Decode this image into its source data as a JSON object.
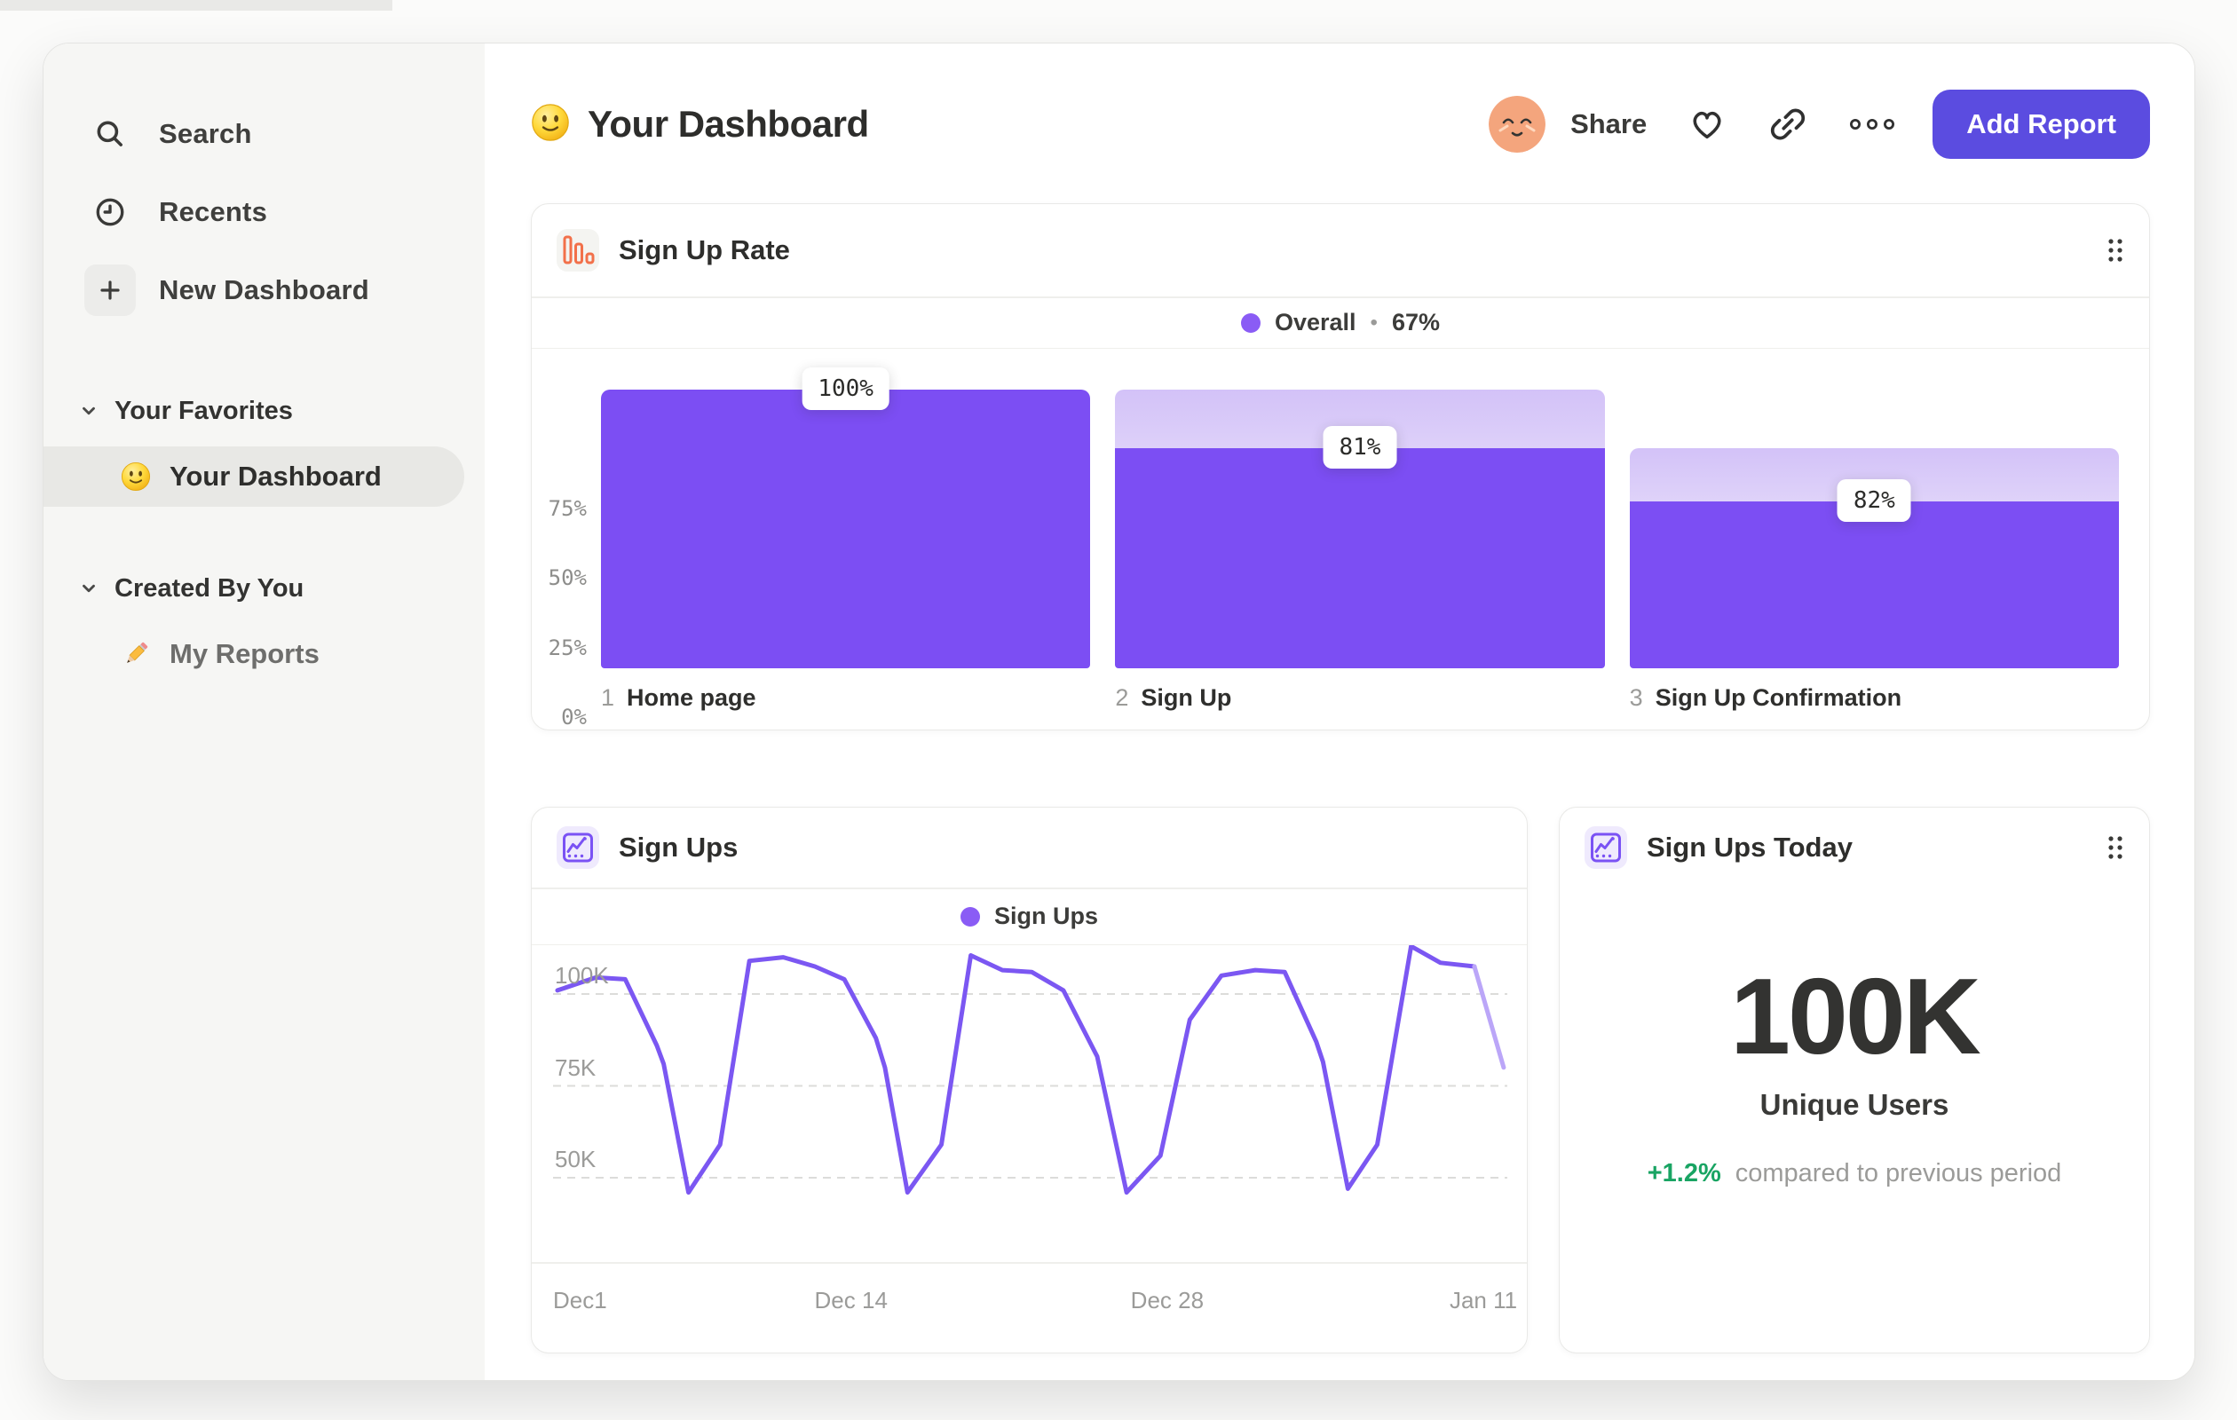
{
  "colors": {
    "bar_purple": "#7c4ef3",
    "line_purple": "#7b57f2",
    "line_purple_light": "#bba6f8",
    "legend_dot_purple": "#8a5cf5",
    "button_purple": "#5b4ce0",
    "green": "#19a463",
    "icon_orange": "#f2704a",
    "icon_purple": "#7a52f4",
    "avatar_peach": "#f4a57d"
  },
  "sidebar": {
    "nav": [
      {
        "icon": "search-icon",
        "label": "Search",
        "boxed": false
      },
      {
        "icon": "clock-icon",
        "label": "Recents",
        "boxed": false
      },
      {
        "icon": "plus-icon",
        "label": "New Dashboard",
        "boxed": true
      }
    ],
    "sections": [
      {
        "label": "Your Favorites",
        "items": [
          {
            "icon": "smiley-emoji",
            "label": "Your Dashboard",
            "selected": true
          }
        ]
      },
      {
        "label": "Created By You",
        "items": [
          {
            "icon": "pencil-emoji",
            "label": "My Reports",
            "selected": false
          }
        ]
      }
    ]
  },
  "header": {
    "title": "Your Dashboard",
    "share": "Share",
    "add_report": "Add Report"
  },
  "funnel_card": {
    "title": "Sign Up Rate",
    "legend": {
      "label": "Overall",
      "separator": "•",
      "value": "67%"
    },
    "y_ticks": [
      {
        "label": "75%",
        "pct": 75
      },
      {
        "label": "50%",
        "pct": 50
      },
      {
        "label": "25%",
        "pct": 25
      },
      {
        "label": "0%",
        "pct": 0
      }
    ],
    "steps": [
      {
        "index": "1",
        "label": "Home page",
        "value_label": "100%",
        "solid_pct": 100,
        "ghost_pct": 0
      },
      {
        "index": "2",
        "label": "Sign Up",
        "value_label": "81%",
        "solid_pct": 79,
        "ghost_pct": 100
      },
      {
        "index": "3",
        "label": "Sign Up Confirmation",
        "value_label": "82%",
        "solid_pct": 60,
        "ghost_pct": 79
      }
    ]
  },
  "line_card": {
    "title": "Sign Ups",
    "legend": {
      "label": "Sign Ups"
    },
    "y_ticks": [
      {
        "label": "100K",
        "value": 100
      },
      {
        "label": "75K",
        "value": 75
      },
      {
        "label": "50K",
        "value": 50
      }
    ],
    "x_ticks": [
      {
        "label": "Dec1",
        "day": 0
      },
      {
        "label": "Dec 14",
        "day": 13
      },
      {
        "label": "Dec 28",
        "day": 27
      },
      {
        "label": "Jan 11",
        "day": 41
      }
    ],
    "solid_points": [
      [
        0,
        101
      ],
      [
        1.7,
        104.5
      ],
      [
        3,
        104
      ],
      [
        4.4,
        86
      ],
      [
        4.7,
        81
      ],
      [
        5.8,
        46
      ],
      [
        7.2,
        59
      ],
      [
        8.5,
        109
      ],
      [
        10,
        110
      ],
      [
        11.4,
        107.5
      ],
      [
        12.7,
        104
      ],
      [
        14.1,
        88
      ],
      [
        14.5,
        80
      ],
      [
        15.5,
        46
      ],
      [
        17,
        59
      ],
      [
        18.3,
        110.5
      ],
      [
        19.7,
        106.5
      ],
      [
        21,
        106
      ],
      [
        22.4,
        101
      ],
      [
        23.9,
        83
      ],
      [
        25.2,
        46
      ],
      [
        26.7,
        56
      ],
      [
        28,
        93
      ],
      [
        29.4,
        105
      ],
      [
        30.9,
        106.5
      ],
      [
        32.2,
        106
      ],
      [
        33.6,
        87
      ],
      [
        33.9,
        81.5
      ],
      [
        35,
        47
      ],
      [
        36.3,
        59
      ],
      [
        37.8,
        113
      ],
      [
        39.1,
        108.5
      ],
      [
        40.6,
        107.5
      ]
    ],
    "light_points": [
      [
        40.6,
        107.5
      ],
      [
        41.9,
        80
      ]
    ]
  },
  "metric_card": {
    "title": "Sign Ups Today",
    "value": "100K",
    "unit_label": "Unique Users",
    "delta": "+1.2%",
    "delta_note": "compared to previous period"
  },
  "chart_data": [
    {
      "type": "bar",
      "subtype": "funnel",
      "title": "Sign Up Rate",
      "categories": [
        "Home page",
        "Sign Up",
        "Sign Up Confirmation"
      ],
      "step_conversion_pct": [
        100,
        81,
        82
      ],
      "overall_conversion_pct": 67,
      "value_labels": [
        "100%",
        "81%",
        "82%"
      ],
      "ylabel": "",
      "xlabel": "",
      "y_ticks": [
        "0%",
        "25%",
        "50%",
        "75%"
      ],
      "legend": "Overall • 67%",
      "legend_position": "top-center"
    },
    {
      "type": "line",
      "title": "Sign Ups",
      "series": [
        {
          "name": "Sign Ups",
          "x_days_from_dec1": [
            0,
            1.7,
            3,
            4.4,
            4.7,
            5.8,
            7.2,
            8.5,
            10,
            11.4,
            12.7,
            14.1,
            14.5,
            15.5,
            17,
            18.3,
            19.7,
            21,
            22.4,
            23.9,
            25.2,
            26.7,
            28,
            29.4,
            30.9,
            32.2,
            33.6,
            33.9,
            35,
            36.3,
            37.8,
            39.1,
            40.6,
            41.9
          ],
          "values_thousands": [
            101,
            104.5,
            104,
            86,
            81,
            46,
            59,
            109,
            110,
            107.5,
            104,
            88,
            80,
            46,
            59,
            110.5,
            106.5,
            106,
            101,
            83,
            46,
            56,
            93,
            105,
            106.5,
            106,
            87,
            81.5,
            47,
            59,
            113,
            108.5,
            107.5,
            80
          ]
        }
      ],
      "x_ticks": [
        "Dec1",
        "Dec 14",
        "Dec 28",
        "Jan 11"
      ],
      "y_ticks": [
        "50K",
        "75K",
        "100K"
      ],
      "ylim_thousands": [
        40,
        115
      ],
      "grid": "horizontal dashed",
      "legend_position": "top-center",
      "note": "segment after Jan 11 drawn lighter (incomplete period)"
    },
    {
      "type": "metric",
      "title": "Sign Ups Today",
      "value": "100K",
      "label": "Unique Users",
      "change": "+1.2%",
      "change_note": "compared to previous period"
    }
  ]
}
